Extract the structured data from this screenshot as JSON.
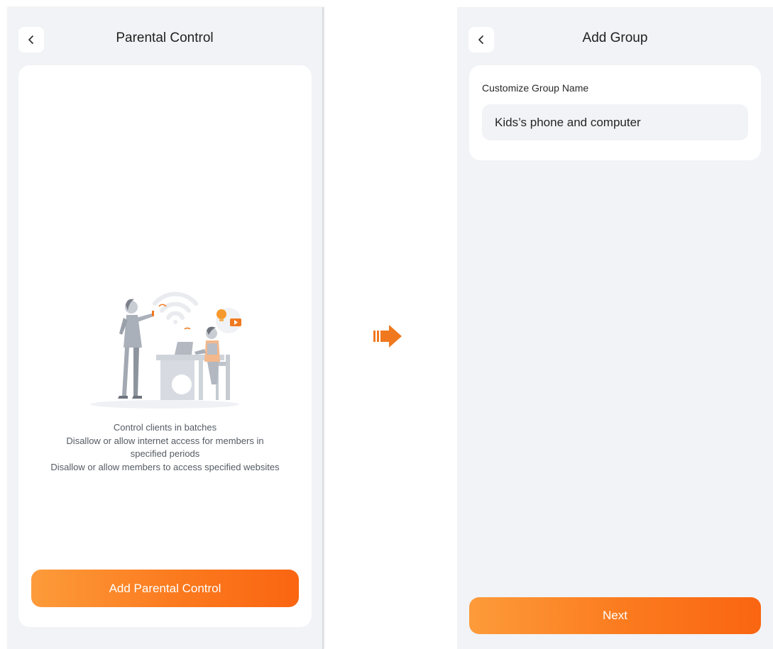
{
  "left_screen": {
    "title": "Parental Control",
    "description": [
      "Control clients in batches",
      "Disallow or allow internet access for members in",
      "specified periods",
      "Disallow or allow members to access specified websites"
    ],
    "primary_button": "Add Parental Control"
  },
  "right_screen": {
    "title": "Add Group",
    "field_label": "Customize Group Name",
    "field_value": "Kids’s phone and computer",
    "primary_button": "Next"
  },
  "icons": {
    "back": "chevron-left-icon",
    "flow": "arrow-right-icon",
    "illustration": "parental-control-illustration"
  },
  "colors": {
    "accent_start": "#fd9b3a",
    "accent_end": "#fa6511",
    "background": "#f1f3f6",
    "card": "#ffffff"
  }
}
